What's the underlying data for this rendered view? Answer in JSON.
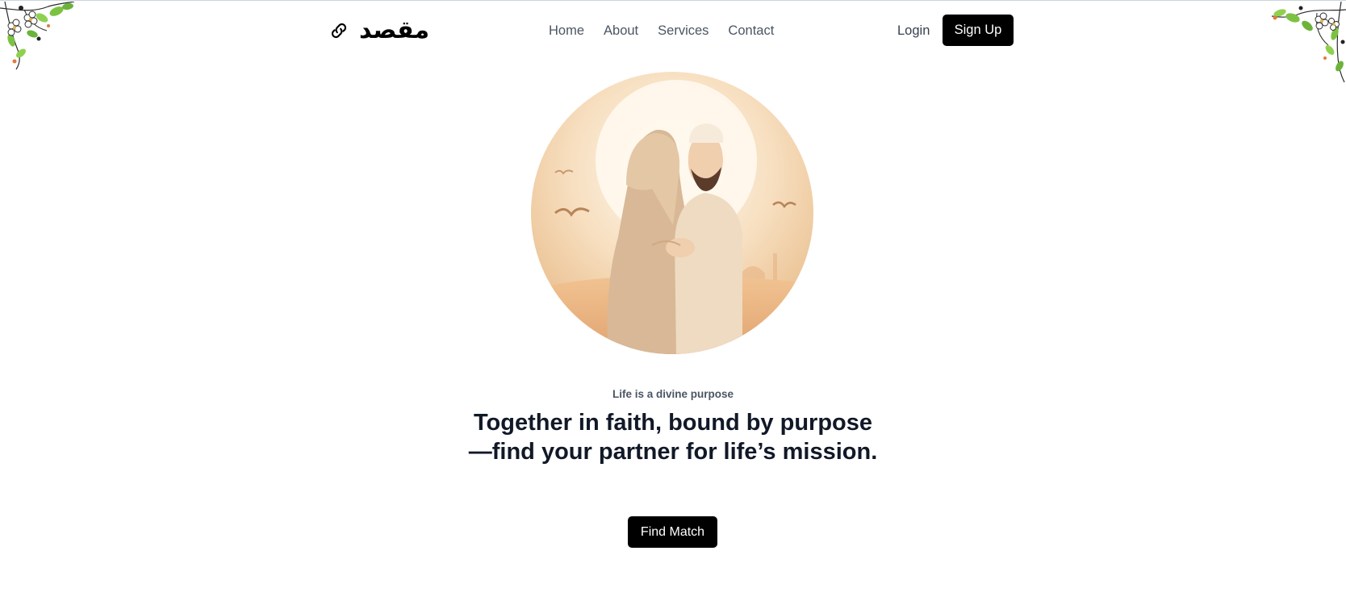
{
  "brand": {
    "name": "مقصد",
    "icon": "link-icon"
  },
  "nav": {
    "items": [
      {
        "label": "Home"
      },
      {
        "label": "About"
      },
      {
        "label": "Services"
      },
      {
        "label": "Contact"
      }
    ]
  },
  "auth": {
    "login_label": "Login",
    "signup_label": "Sign Up"
  },
  "hero": {
    "image": "couple-illustration",
    "tagline": "Life is a divine purpose",
    "headline": "Together in faith, bound by purpose—find your partner for life’s mission.",
    "cta_label": "Find Match"
  },
  "decorations": {
    "corners": "floral-corner-icon"
  },
  "colors": {
    "primary": "#000000",
    "text_dark": "#111827",
    "text_muted": "#4b5563",
    "leaf_green": "#7cc242"
  }
}
